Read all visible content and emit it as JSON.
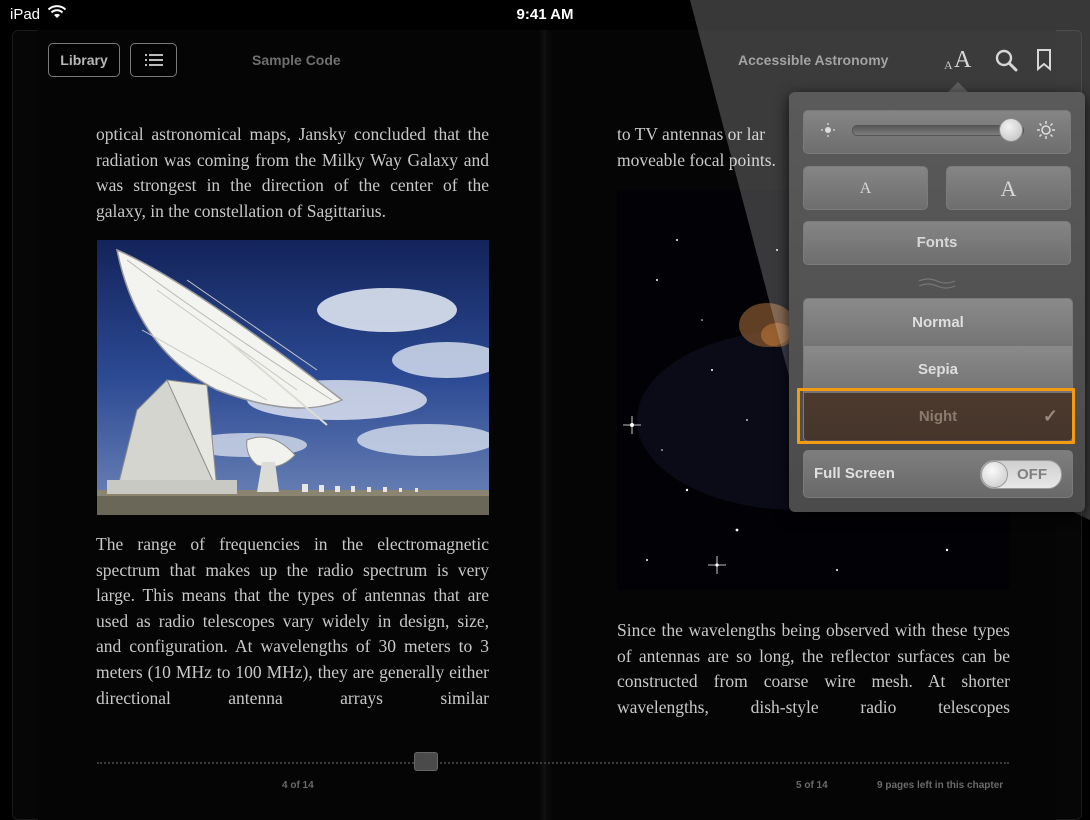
{
  "status_bar": {
    "device": "iPad",
    "time": "9:41 AM"
  },
  "toolbar": {
    "library_label": "Library",
    "book_title": "Sample Code",
    "chapter_title": "Accessible Astronomy",
    "font_size_small": "A",
    "font_size_large": "A"
  },
  "left_page": {
    "para1": "optical astronomical maps, Jansky concluded that the radiation was coming from the Milky Way Galaxy and was strongest in the direction of the center of the galaxy, in the constellation of Sagittarius.",
    "para2": "The range of frequencies in the electromagnetic spectrum that makes up the radio spectrum is very large. This means that the types of antennas that are used as radio telescopes vary widely in design, size, and configuration. At wavelengths of 30 meters to 3 meters (10 MHz to 100 MHz), they are generally either directional antenna arrays similar",
    "page_number": "4 of 14"
  },
  "right_page": {
    "para1": "to TV antennas or lar moveable focal points.",
    "para2": "Since the wavelengths being observed with these types of antennas are so long, the reflector surfaces can be constructed from coarse wire mesh. At shorter wavelengths, dish-style radio telescopes",
    "page_number": "5 of 14",
    "pages_left": "9 pages left in this chapter"
  },
  "popover": {
    "brightness": 0.95,
    "smaller_label": "A",
    "larger_label": "A",
    "fonts_label": "Fonts",
    "themes": [
      {
        "label": "Normal",
        "selected": false
      },
      {
        "label": "Sepia",
        "selected": false
      },
      {
        "label": "Night",
        "selected": true
      }
    ],
    "full_screen_label": "Full Screen",
    "full_screen_state": "OFF",
    "checkmark": "✓"
  },
  "colors": {
    "highlight": "#f39c0f",
    "night_theme": "#4a382d"
  }
}
